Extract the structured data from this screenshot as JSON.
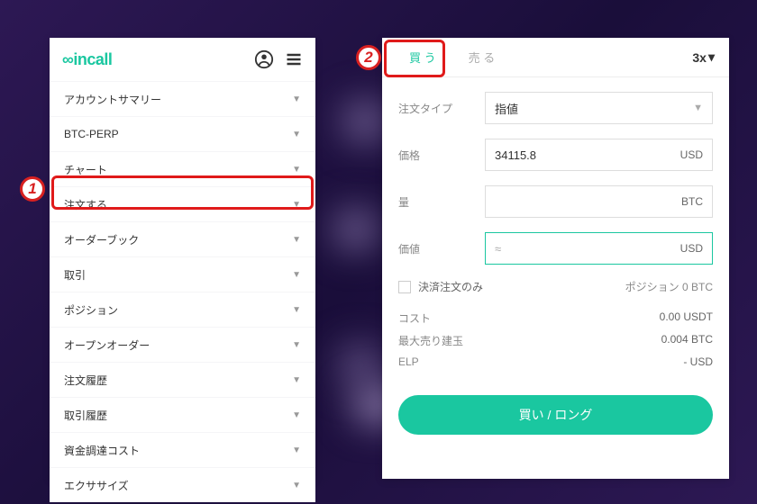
{
  "annotations": {
    "badge1": "1",
    "badge2": "2"
  },
  "left": {
    "logo": "incall",
    "menu": [
      "アカウントサマリー",
      "BTC-PERP",
      "チャート",
      "注文する",
      "オーダーブック",
      "取引",
      "ポジション",
      "オープンオーダー",
      "注文履歴",
      "取引履歴",
      "資金調達コスト",
      "エクササイズ"
    ]
  },
  "right": {
    "tabs": {
      "buy": "買 う",
      "sell": "売 る"
    },
    "leverage": "3x",
    "orderType": {
      "label": "注文タイプ",
      "value": "指値"
    },
    "price": {
      "label": "価格",
      "value": "34115.8",
      "unit": "USD"
    },
    "amount": {
      "label": "量",
      "value": "",
      "unit": "BTC"
    },
    "worth": {
      "label": "価値",
      "approx": "≈",
      "unit": "USD"
    },
    "settleOnly": "決済注文のみ",
    "position": {
      "label": "ポジション",
      "value": "0 BTC"
    },
    "cost": {
      "label": "コスト",
      "value": "0.00 USDT"
    },
    "maxSell": {
      "label": "最大売り建玉",
      "value": "0.004 BTC"
    },
    "elp": {
      "label": "ELP",
      "value": "- USD"
    },
    "buyButton": "買い / ロング"
  }
}
